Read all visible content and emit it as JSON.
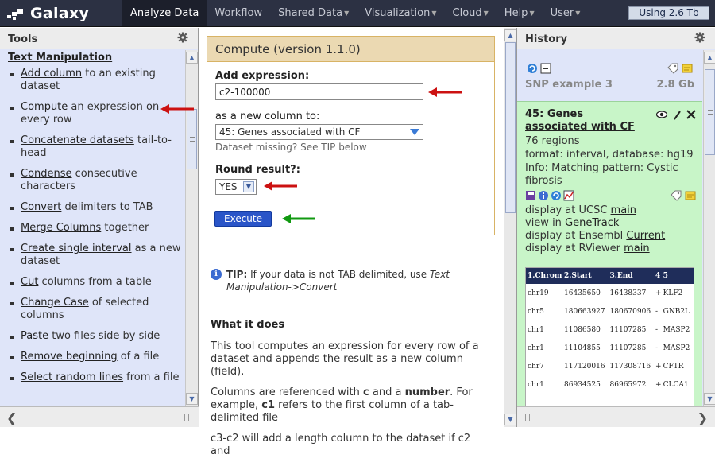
{
  "masthead": {
    "brand": "Galaxy",
    "tabs": [
      {
        "label": "Analyze Data",
        "active": true,
        "dropdown": false
      },
      {
        "label": "Workflow",
        "active": false,
        "dropdown": false
      },
      {
        "label": "Shared Data",
        "active": false,
        "dropdown": true
      },
      {
        "label": "Visualization",
        "active": false,
        "dropdown": true
      },
      {
        "label": "Cloud",
        "active": false,
        "dropdown": true
      },
      {
        "label": "Help",
        "active": false,
        "dropdown": true
      },
      {
        "label": "User",
        "active": false,
        "dropdown": true
      }
    ],
    "usage": "Using 2.6 Tb"
  },
  "tools_panel": {
    "header": "Tools",
    "section_title": "Text Manipulation",
    "items": [
      {
        "link": "Add column",
        "rest": " to an existing dataset"
      },
      {
        "link": "Compute",
        "rest": " an expression on every row"
      },
      {
        "link": "Concatenate datasets",
        "rest": " tail-to-head"
      },
      {
        "link": "Condense",
        "rest": " consecutive characters"
      },
      {
        "link": "Convert",
        "rest": " delimiters to TAB"
      },
      {
        "link": "Merge Columns",
        "rest": " together"
      },
      {
        "link": "Create single interval",
        "rest": " as a new dataset"
      },
      {
        "link": "Cut",
        "rest": " columns from a table"
      },
      {
        "link": "Change Case",
        "rest": " of selected columns"
      },
      {
        "link": "Paste",
        "rest": " two files side by side"
      },
      {
        "link": "Remove beginning",
        "rest": " of a file"
      },
      {
        "link": "Select random lines",
        "rest": " from a file"
      }
    ]
  },
  "tool_form": {
    "title": "Compute (version 1.1.0)",
    "expression_label": "Add expression:",
    "expression_value": "c2-100000",
    "column_label": "as a new column to:",
    "column_value": "45: Genes associated with CF",
    "column_help": "Dataset missing? See TIP below",
    "round_label": "Round result?:",
    "round_value": "YES",
    "execute_label": "Execute"
  },
  "tip": {
    "label": "TIP:",
    "text": " If your data is not TAB delimited, use ",
    "emph": "Text Manipulation->Convert"
  },
  "what_it_does": {
    "heading": "What it does",
    "p1": "This tool computes an expression for every row of a dataset and appends the result as a new column (field).",
    "p2_a": "Columns are referenced with ",
    "p2_c": "c",
    "p2_b": " and a ",
    "p2_num": "number",
    "p2_d": ". For example, ",
    "p2_c1": "c1",
    "p2_e": " refers to the first column of a tab-delimited file",
    "p3": "c3-c2 will add a length column to the dataset if c2 and"
  },
  "history_panel": {
    "header": "History",
    "history_name": "SNP example 3",
    "history_size": "2.8 Gb",
    "dataset": {
      "title": "45: Genes associated with CF",
      "regions": "76 regions",
      "format": "format: interval, database: hg19",
      "info": "Info: Matching pattern: Cystic fibrosis",
      "display_ucsc_pre": "display at UCSC ",
      "display_ucsc_link": "main",
      "view_pre": "view in ",
      "view_link": "GeneTrack",
      "ensembl_pre": "display at Ensembl ",
      "ensembl_link": "Current",
      "rviewer_pre": "display at RViewer ",
      "rviewer_link": "main"
    },
    "peek_headers": [
      "1.Chrom",
      "2.Start",
      "3.End",
      "4",
      "5"
    ],
    "peek_rows": [
      [
        "chr19",
        "16435650",
        "16438337",
        "+",
        "KLF2"
      ],
      [
        "chr5",
        "180663927",
        "180670906",
        "-",
        "GNB2L"
      ],
      [
        "chr1",
        "11086580",
        "11107285",
        "-",
        "MASP2"
      ],
      [
        "chr1",
        "11104855",
        "11107285",
        "-",
        "MASP2"
      ],
      [
        "chr7",
        "117120016",
        "117308716",
        "+",
        "CFTR"
      ],
      [
        "chr1",
        "86934525",
        "86965972",
        "+",
        "CLCA1"
      ]
    ]
  },
  "colors": {
    "masthead": "#2c3143",
    "panel_bg": "#dfe5f9",
    "form_header": "#ebd9b2",
    "dataset_ok": "#c8f5c8",
    "execute_btn": "#2a55c8",
    "annotation_arrow_red": "#cc1111",
    "annotation_arrow_green": "#119911"
  }
}
